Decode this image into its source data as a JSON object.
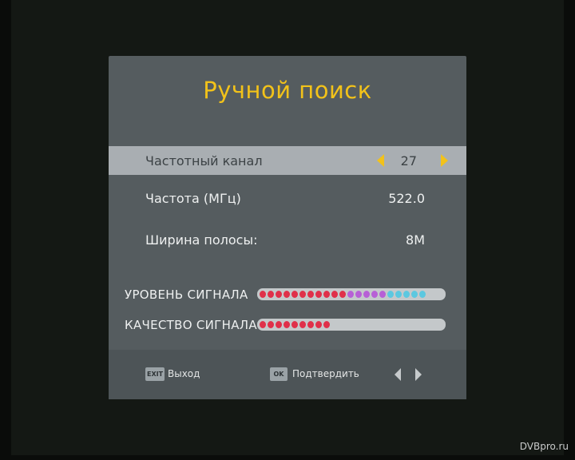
{
  "dialog": {
    "title": "Ручной поиск",
    "rows": [
      {
        "label": "Частотный канал",
        "value": "27"
      },
      {
        "label": "Частота (МГц)",
        "value": "522.0"
      },
      {
        "label": "Ширина полосы:",
        "value": "8M"
      }
    ],
    "signal_level": {
      "label": "УРОВЕНЬ СИГНАЛА",
      "dots": 21,
      "total": 25
    },
    "signal_quality": {
      "label": "КАЧЕСТВО СИГНАЛА",
      "dots": 9,
      "total": 25
    }
  },
  "footer": {
    "exit_key": "EXIT",
    "exit_label": "Выход",
    "ok_key": "OK",
    "ok_label": "Подтвердить"
  },
  "watermark": "DVBpro.ru",
  "colors": {
    "title": "#f2c21a",
    "dot_red": "#e0304a",
    "dot_purple": "#b760d6",
    "dot_cyan": "#5cc8e0"
  },
  "icons": [
    "arrow-left-icon",
    "arrow-right-icon",
    "nav-left-icon",
    "nav-right-icon"
  ]
}
